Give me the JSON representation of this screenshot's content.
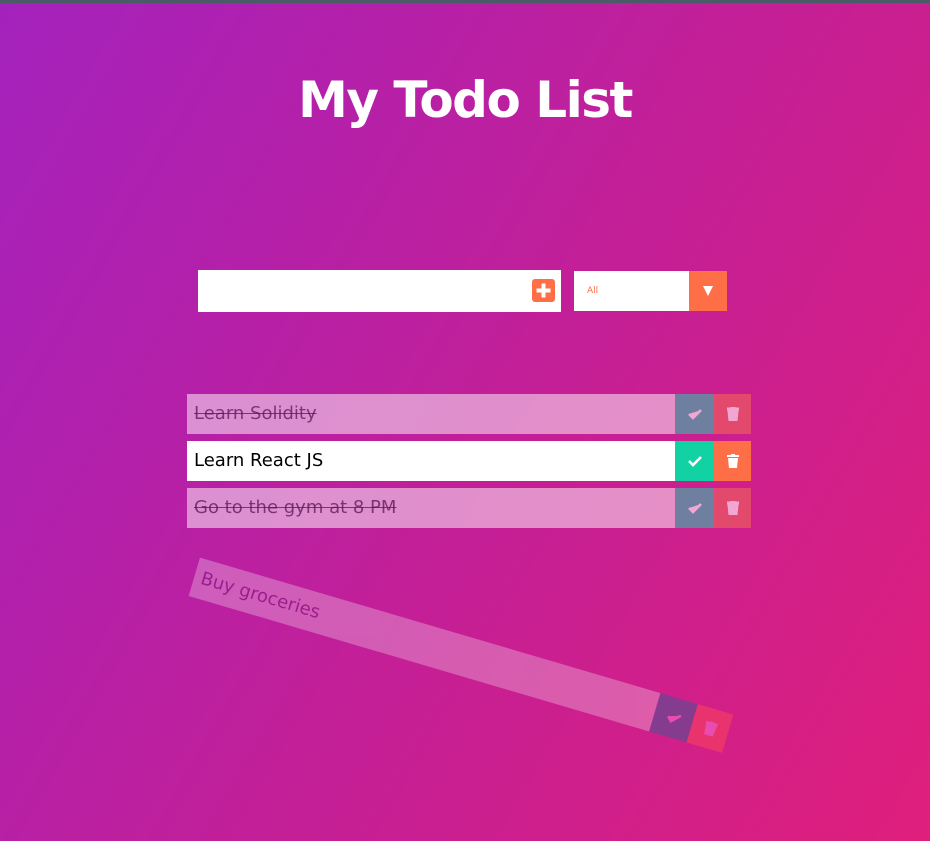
{
  "app": {
    "title": "My Todo List"
  },
  "form": {
    "input_value": "",
    "input_placeholder": "",
    "add_icon": "plus-icon",
    "filter": {
      "selected": "All",
      "arrow_icon": "triangle-down-icon"
    }
  },
  "todos": [
    {
      "text": "Learn Solidity",
      "completed": true
    },
    {
      "text": "Learn React JS",
      "completed": false
    },
    {
      "text": "Go to the gym at 8 PM",
      "completed": true
    },
    {
      "text": "Buy groceries",
      "completed": true,
      "being_deleted": true
    }
  ],
  "icons": {
    "check": "check-icon",
    "trash": "trash-icon"
  },
  "colors": {
    "accent": "#ff6f47",
    "check": "#12d2a3",
    "gradient_start": "#a422bd",
    "gradient_end": "#df1f7c"
  }
}
